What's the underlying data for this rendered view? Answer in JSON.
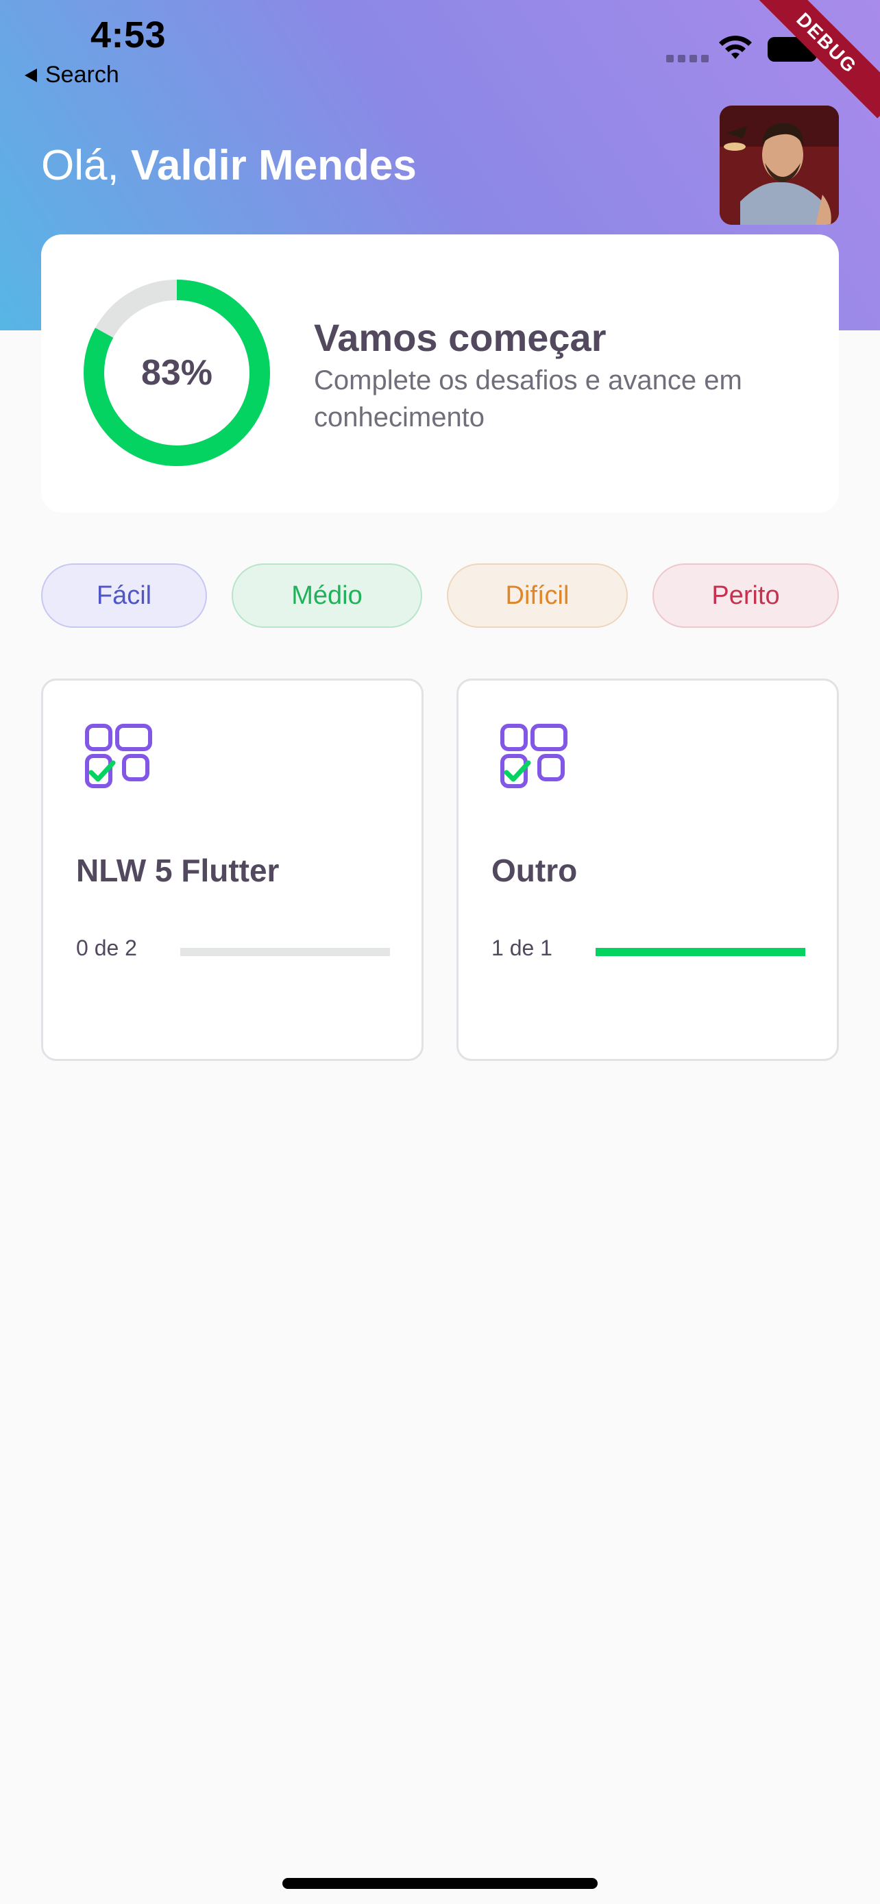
{
  "status_bar": {
    "time": "4:53",
    "back_label": "Search"
  },
  "debug_banner": "DEBUG",
  "header": {
    "greeting_prefix": "Olá, ",
    "user_name": "Valdir Mendes"
  },
  "score_card": {
    "percent": 0.83,
    "percent_label": "83%",
    "title": "Vamos começar",
    "subtitle": "Complete os desafios e avance em conhecimento"
  },
  "levels": [
    {
      "label": "Fácil"
    },
    {
      "label": "Médio"
    },
    {
      "label": "Difícil"
    },
    {
      "label": "Perito"
    }
  ],
  "quizzes": [
    {
      "title": "NLW 5 Flutter",
      "progress_label": "0 de 2",
      "progress": 0
    },
    {
      "title": "Outro",
      "progress_label": "1 de 1",
      "progress": 1
    }
  ],
  "colors": {
    "header_gradient": [
      "#57B6E5",
      "#A88BEB"
    ],
    "progress_green": "#04D361",
    "ring_track": "#E1E3E3",
    "heading_text": "#52495F",
    "icon_purple": "#8257E5"
  },
  "icons": {
    "quiz_card": "checklist-icon",
    "avatar": "user-photo"
  }
}
